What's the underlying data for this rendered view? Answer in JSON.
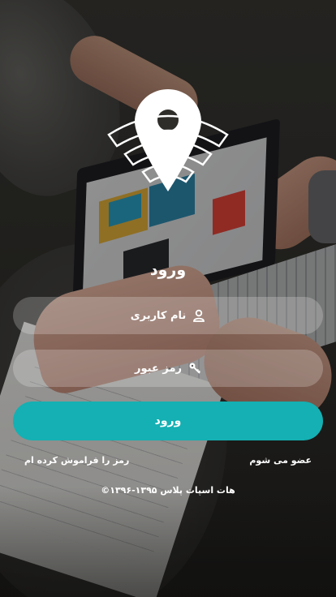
{
  "logo": {
    "icon": "location-pin-wifi-icon"
  },
  "login_form": {
    "title": "ورود",
    "username": {
      "placeholder": "نام کاربری",
      "icon": "user-icon"
    },
    "password": {
      "placeholder": "رمز عبور",
      "icon": "key-icon"
    },
    "submit_label": "ورود"
  },
  "links": {
    "forgot_password": "رمز را فراموش کرده ام",
    "register": "عضو می شوم"
  },
  "footer": {
    "copyright": "©۱۳۹۶-۱۳۹۵ هات اسپات پلاس"
  },
  "colors": {
    "accent": "#14b0b3",
    "text": "#ffffff",
    "field_bg": "rgba(255,255,255,0.22)"
  }
}
